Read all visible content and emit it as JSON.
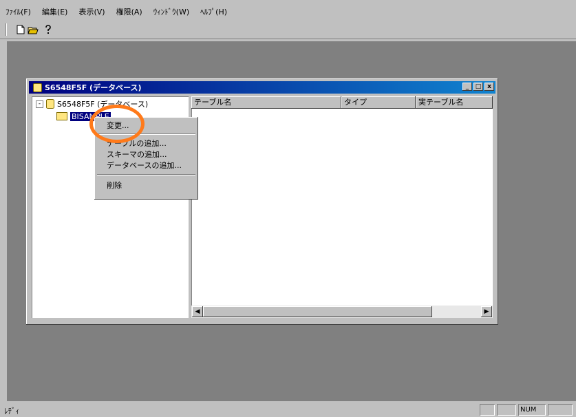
{
  "menubar": {
    "items": [
      {
        "label": "ﾌｧｲﾙ(F)"
      },
      {
        "label": "編集(E)"
      },
      {
        "label": "表示(V)"
      },
      {
        "label": "権限(A)"
      },
      {
        "label": "ｳｨﾝﾄﾞｳ(W)"
      },
      {
        "label": "ﾍﾙﾌﾟ(H)"
      }
    ]
  },
  "toolbar": {
    "buttons": [
      {
        "icon": "new-document-icon",
        "glyph": "🗋"
      },
      {
        "icon": "open-folder-icon",
        "glyph": "📂"
      },
      {
        "icon": "help-icon",
        "glyph": "?"
      }
    ]
  },
  "window": {
    "title": "S6548F5F (データベース)",
    "minimize": "_",
    "maximize": "□",
    "close": "x"
  },
  "tree": {
    "root": {
      "expander": "-",
      "label": "S6548F5F (データベース)"
    },
    "child": {
      "label": "BISAMPLE"
    }
  },
  "list": {
    "columns": [
      "テーブル名",
      "タイプ",
      "実テーブル名"
    ],
    "scroll_left": "◀",
    "scroll_right": "▶"
  },
  "context_menu": {
    "items": [
      "変更...",
      "テーブルの追加...",
      "スキーマの追加...",
      "データベースの追加...",
      "削除"
    ]
  },
  "statusbar": {
    "text": "ﾚﾃﾞｨ",
    "num": "NUM"
  },
  "colors": {
    "highlight_ring": "#ff7a1a",
    "title_bar": "#00007f",
    "workspace": "#808080"
  }
}
